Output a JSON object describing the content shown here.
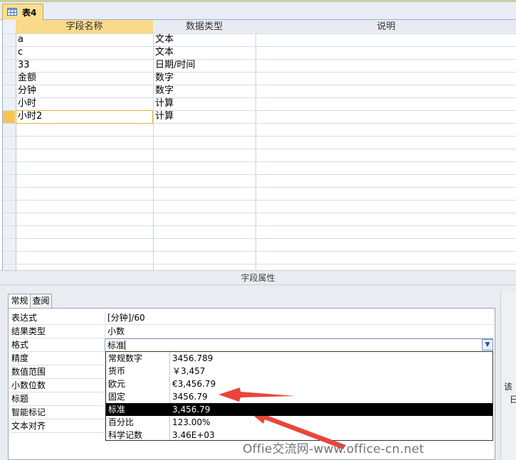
{
  "tab": {
    "title": "表4",
    "icon": "table-icon"
  },
  "grid": {
    "headers": {
      "field": "字段名称",
      "type": "数据类型",
      "desc": "说明"
    },
    "rows": [
      {
        "field": "a",
        "type": "文本",
        "desc": ""
      },
      {
        "field": "c",
        "type": "文本",
        "desc": ""
      },
      {
        "field": "33",
        "type": "日期/时间",
        "desc": ""
      },
      {
        "field": "金额",
        "type": "数字",
        "desc": ""
      },
      {
        "field": "分钟",
        "type": "数字",
        "desc": ""
      },
      {
        "field": "小时",
        "type": "计算",
        "desc": ""
      },
      {
        "field": "小时2",
        "type": "计算",
        "desc": ""
      }
    ],
    "active_row": 6
  },
  "properties": {
    "bar_title": "字段属性",
    "tabs": [
      "常规",
      "查阅"
    ],
    "active_tab": 0,
    "rows": [
      {
        "label": "表达式",
        "value": "[分钟]/60"
      },
      {
        "label": "结果类型",
        "value": "小数"
      },
      {
        "label": "格式",
        "value": "标准"
      },
      {
        "label": "精度",
        "value": ""
      },
      {
        "label": "数值范围",
        "value": ""
      },
      {
        "label": "小数位数",
        "value": ""
      },
      {
        "label": "标题",
        "value": ""
      },
      {
        "label": "智能标记",
        "value": ""
      },
      {
        "label": "文本对齐",
        "value": ""
      }
    ]
  },
  "format_dropdown": {
    "selected_index": 4,
    "options": [
      {
        "name": "常规数字",
        "sample": "3456.789"
      },
      {
        "name": "货币",
        "sample": "￥3,457"
      },
      {
        "name": "欧元",
        "sample": "€3,456.79"
      },
      {
        "name": "固定",
        "sample": "3456.79"
      },
      {
        "name": "标准",
        "sample": "3,456.79"
      },
      {
        "name": "百分比",
        "sample": "123.00%"
      },
      {
        "name": "科学记数",
        "sample": "3.46E+03"
      }
    ]
  },
  "help_panel": {
    "text_1": "该",
    "text_2": "日"
  },
  "annotations": {
    "arrow_color": "#e8463c",
    "arrow_count": 2
  },
  "watermark": "Offie交流网-www.office-cn.net",
  "colors": {
    "active_header": "#f9d98a",
    "selected_option": "#000000",
    "tab_active": "#f9df91"
  }
}
